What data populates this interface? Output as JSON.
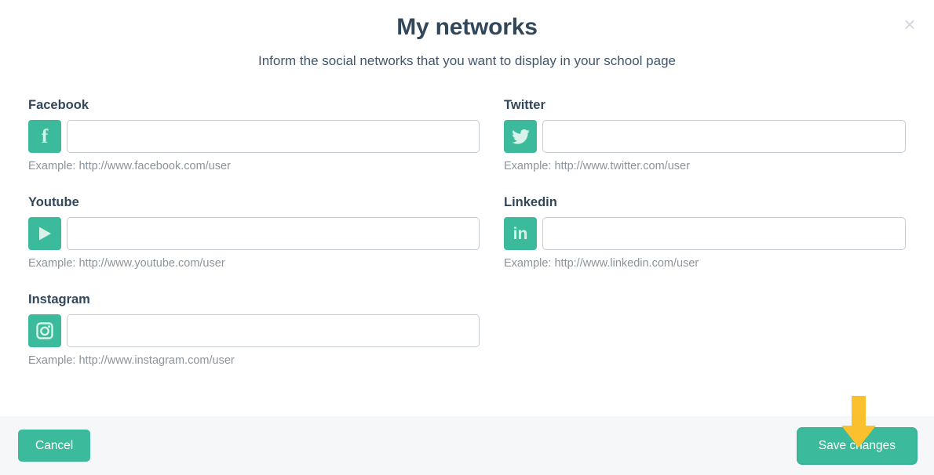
{
  "dialog": {
    "title": "My networks",
    "subtitle": "Inform the social networks that you want to display in your school page",
    "close_label": "×"
  },
  "colors": {
    "accent_green": "#3bbb9b",
    "title_navy": "#33475b",
    "helper_gray": "#8c949d",
    "input_border": "#c5cbd3",
    "footer_bg": "#f5f7f9",
    "annotation_yellow": "#fbc02d"
  },
  "networks": [
    {
      "key": "facebook",
      "label": "Facebook",
      "icon": "facebook-icon",
      "value": "",
      "placeholder": "",
      "help": "Example: http://www.facebook.com/user"
    },
    {
      "key": "twitter",
      "label": "Twitter",
      "icon": "twitter-icon",
      "value": "",
      "placeholder": "",
      "help": "Example: http://www.twitter.com/user"
    },
    {
      "key": "youtube",
      "label": "Youtube",
      "icon": "youtube-icon",
      "value": "",
      "placeholder": "",
      "help": "Example: http://www.youtube.com/user"
    },
    {
      "key": "linkedin",
      "label": "Linkedin",
      "icon": "linkedin-icon",
      "value": "",
      "placeholder": "",
      "help": "Example: http://www.linkedin.com/user"
    },
    {
      "key": "instagram",
      "label": "Instagram",
      "icon": "instagram-icon",
      "value": "",
      "placeholder": "",
      "help": "Example: http://www.instagram.com/user"
    }
  ],
  "footer": {
    "cancel_label": "Cancel",
    "save_label": "Save changes"
  },
  "annotation": {
    "arrow": "down-arrow-icon",
    "points_at": "Save changes"
  }
}
